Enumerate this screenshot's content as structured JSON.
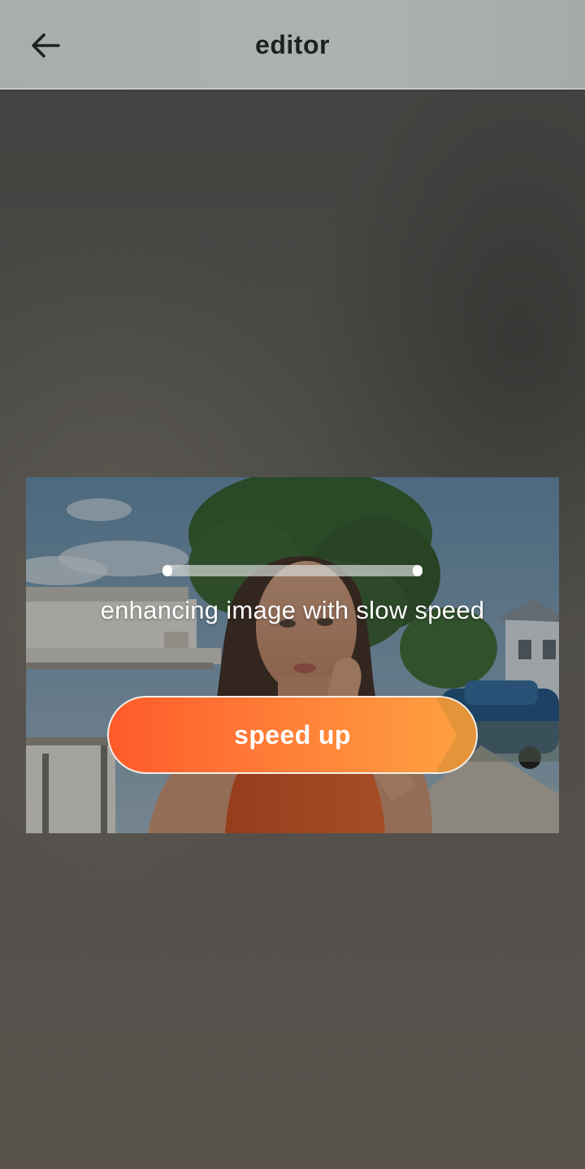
{
  "app_bar": {
    "title": "editor",
    "back_icon": "arrow-left-icon"
  },
  "processing": {
    "progress": 1.0,
    "status_text": "enhancing image with slow speed",
    "speed_up_label": "speed up"
  },
  "colors": {
    "accent_start": "#ff5a2a",
    "accent_end": "#ffa342",
    "app_bar_bg": "#abafad",
    "title_text": "#1c2220"
  }
}
